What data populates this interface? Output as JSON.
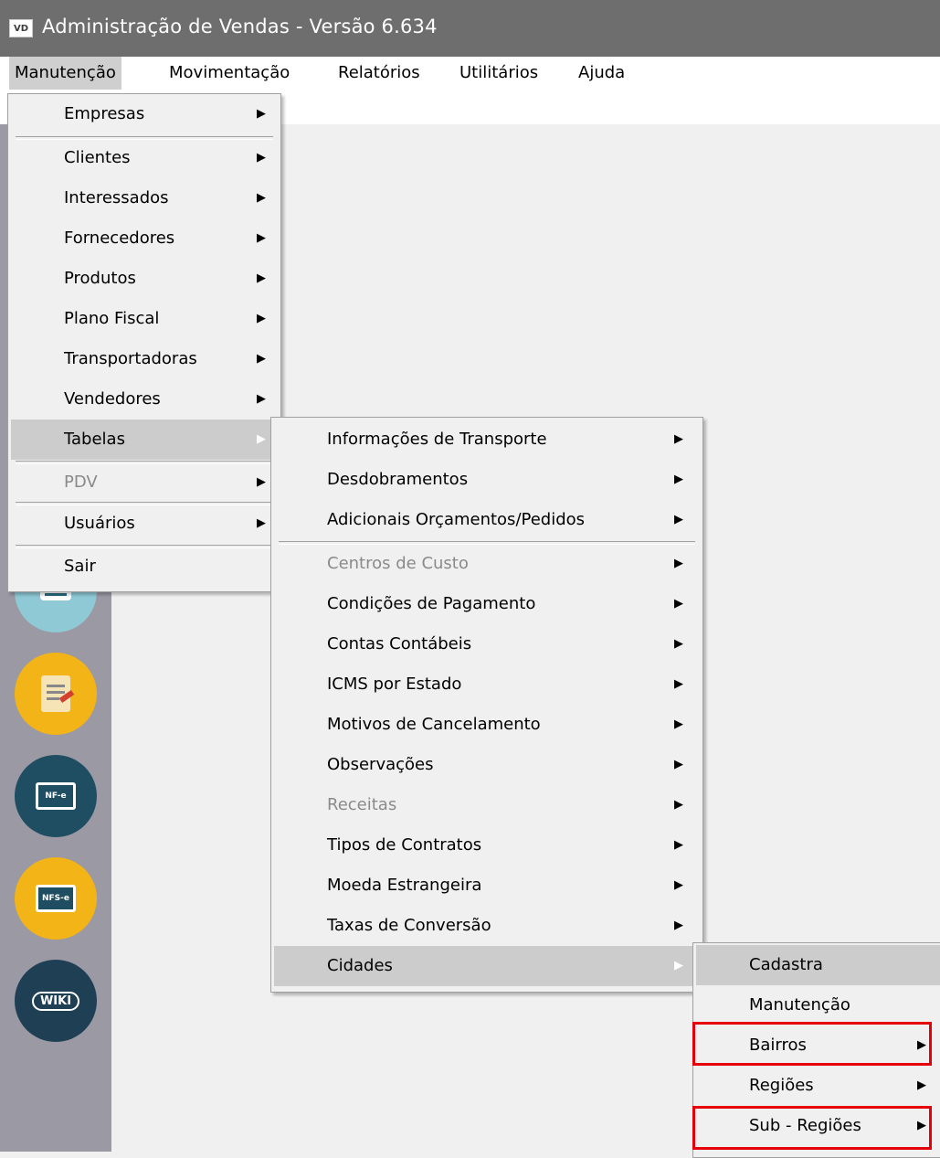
{
  "window": {
    "app_icon_text": "VD",
    "title": "Administração de Vendas - Versão 6.634"
  },
  "menubar": [
    "Manutenção",
    "Movimentação",
    "Relatórios",
    "Utilitários",
    "Ajuda"
  ],
  "menu_manutencao": [
    {
      "label": "Empresas"
    },
    {
      "label": "Clientes"
    },
    {
      "label": "Interessados"
    },
    {
      "label": "Fornecedores"
    },
    {
      "label": "Produtos"
    },
    {
      "label": "Plano Fiscal"
    },
    {
      "label": "Transportadoras"
    },
    {
      "label": "Vendedores"
    },
    {
      "label": "Tabelas"
    },
    {
      "label": "PDV"
    },
    {
      "label": "Usuários"
    },
    {
      "label": "Sair"
    }
  ],
  "menu_tabelas": [
    {
      "label": "Informações de Transporte"
    },
    {
      "label": "Desdobramentos"
    },
    {
      "label": "Adicionais Orçamentos/Pedidos"
    },
    {
      "label": "Centros de Custo"
    },
    {
      "label": "Condições de Pagamento"
    },
    {
      "label": "Contas Contábeis"
    },
    {
      "label": "ICMS por Estado"
    },
    {
      "label": "Motivos de Cancelamento"
    },
    {
      "label": "Observações"
    },
    {
      "label": "Receitas"
    },
    {
      "label": "Tipos de Contratos"
    },
    {
      "label": "Moeda Estrangeira"
    },
    {
      "label": "Taxas de Conversão"
    },
    {
      "label": "Cidades"
    }
  ],
  "menu_cidades": [
    {
      "label": "Cadastra"
    },
    {
      "label": "Manutenção"
    },
    {
      "label": "Bairros"
    },
    {
      "label": "Regiões"
    },
    {
      "label": "Sub - Regiões"
    }
  ],
  "sidebar_icons": [
    {
      "name": "nfe-icon",
      "text": "NF-e"
    },
    {
      "name": "nfse-icon",
      "text": "NFS-e"
    },
    {
      "name": "wiki-icon",
      "text": "WIKI"
    }
  ],
  "colors": {
    "highlight": "#cccccc",
    "annotation_red": "#e6000a",
    "sidebar_bg": "#9b99a4"
  }
}
